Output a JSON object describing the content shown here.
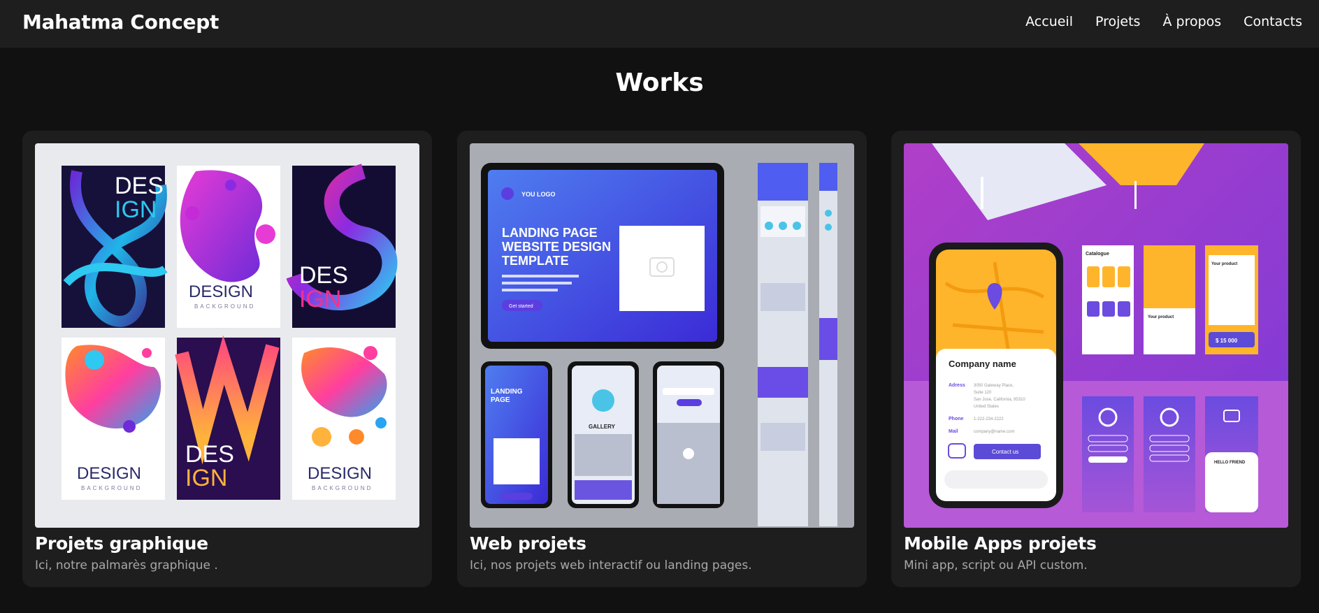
{
  "header": {
    "brand": "Mahatma Concept",
    "nav": [
      "Accueil",
      "Projets",
      "À propos",
      "Contacts"
    ]
  },
  "works": {
    "title": "Works",
    "cards": [
      {
        "title": "Projets graphique",
        "description": "Ici, notre palmarès graphique .",
        "image": {
          "text": [
            "DES",
            "IGN",
            "DESIGN",
            "BACKGROUND"
          ]
        }
      },
      {
        "title": "Web projets",
        "description": "Ici, nos projets web interactif ou landing pages.",
        "image": {
          "logo": "YOU LOGO",
          "headline": [
            "LANDING PAGE",
            "WEBSITE DESIGN",
            "TEMPLATE"
          ],
          "button": "Get started",
          "gallery": "GALLERY"
        }
      },
      {
        "title": "Mobile Apps projets",
        "description": "Mini app, script ou API custom.",
        "image": {
          "company": "Company name",
          "address_label": "Adress",
          "address": [
            "3050 Gateway Place,",
            "Suite 120",
            "San Jose, California, 95310",
            "United States"
          ],
          "phone_label": "Phone",
          "phone": "1-222-234-2222",
          "mail_label": "Mail",
          "mail": "company@name.com",
          "button": "Contact us",
          "catalogue": "Catalogue",
          "product": "Your product",
          "price": "$ 15 000",
          "hello": "HELLO FRIEND"
        }
      }
    ]
  },
  "colors": {
    "background": "#111111",
    "navbar": "#1e1e1e",
    "card": "#1e1e1e",
    "text": "#ffffff",
    "muted": "#a8a8a8"
  }
}
